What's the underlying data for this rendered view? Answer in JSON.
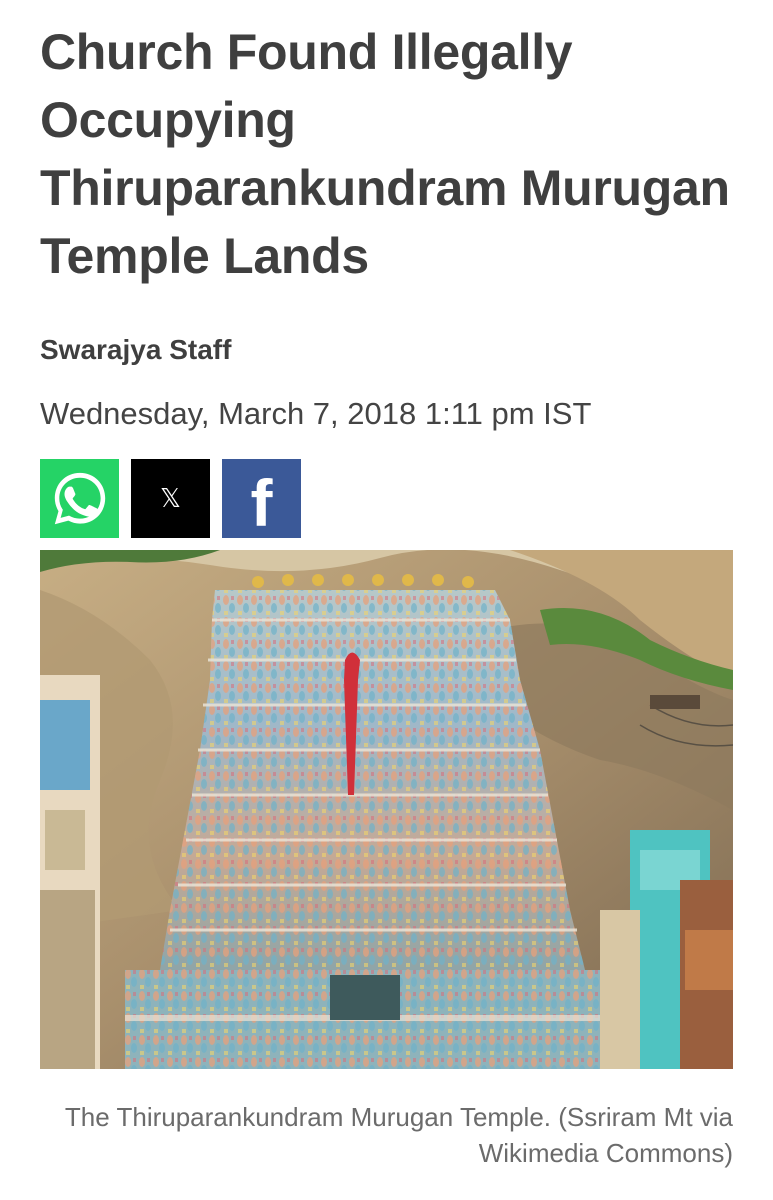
{
  "article": {
    "headline": "Church Found Illegally Occupying Thiruparankundram Murugan Temple Lands",
    "author": "Swarajya Staff",
    "dateline": "Wednesday, March 7, 2018 1:11 pm IST"
  },
  "share": {
    "buttons": [
      {
        "network": "WhatsApp",
        "icon": "whatsapp-icon",
        "color": "#25D366"
      },
      {
        "network": "X",
        "icon": "x-icon",
        "glyph": "𝕏",
        "color": "#000000"
      },
      {
        "network": "Facebook",
        "icon": "facebook-icon",
        "glyph": "f",
        "color": "#3b5998"
      }
    ]
  },
  "image": {
    "subject": "Temple gopuram photograph",
    "caption": "The Thiruparankundram Murugan Temple. (Ssriram Mt via Wikimedia Commons)"
  },
  "colors": {
    "text": "#3f3f3f",
    "caption": "#6b6b6b",
    "whatsapp": "#25D366",
    "x": "#000000",
    "facebook": "#3b5998"
  }
}
